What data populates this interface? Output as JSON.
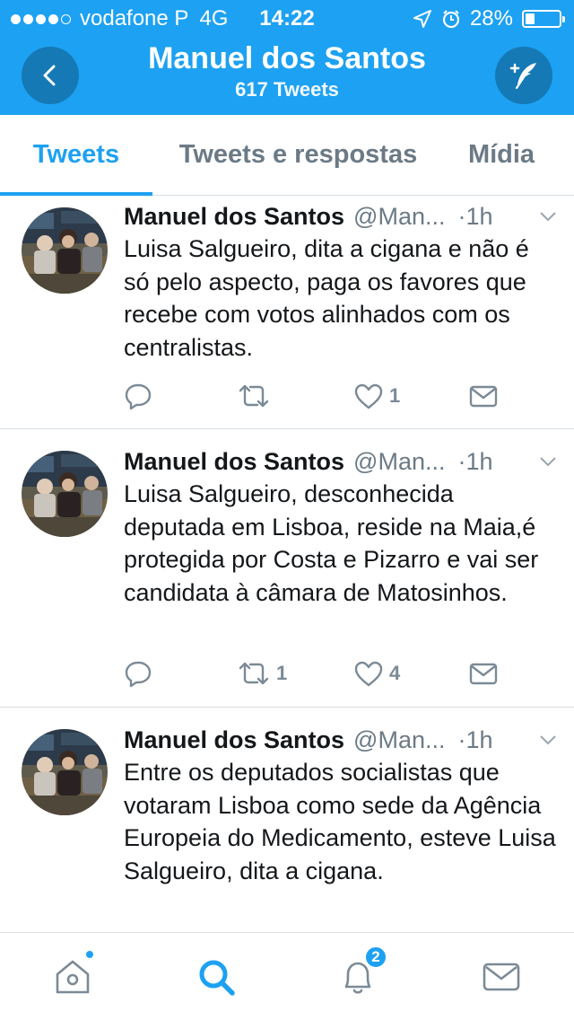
{
  "status_bar": {
    "carrier": "vodafone P",
    "network": "4G",
    "time": "14:22",
    "battery": "28%",
    "battery_level": 0.28,
    "signal_bars_filled": 4,
    "signal_bars_total": 5
  },
  "header": {
    "title": "Manuel dos Santos",
    "subtitle": "617 Tweets",
    "back_icon": "chevron-left-icon",
    "compose_icon": "compose-tweet-icon"
  },
  "tabs": [
    {
      "label": "Tweets",
      "active": true
    },
    {
      "label": "Tweets e respostas",
      "active": false
    },
    {
      "label": "Mídia",
      "active": false
    }
  ],
  "tweets": [
    {
      "name": "Manuel dos Santos",
      "handle": "@Man...",
      "separator": "·",
      "time": "1h",
      "text": "Luisa Salgueiro, dita a cigana e não é só pelo aspecto, paga os favores que recebe com votos alinhados com os centralistas.",
      "replies": "",
      "retweets": "",
      "likes": "1"
    },
    {
      "name": "Manuel dos Santos",
      "handle": "@Man...",
      "separator": "·",
      "time": "1h",
      "text": "Luisa Salgueiro, desconhecida deputada em Lisboa, reside na Maia,é protegida por Costa e Pizarro e vai ser candidata à câmara de Matosinhos.",
      "replies": "",
      "retweets": "1",
      "likes": "4"
    },
    {
      "name": "Manuel dos Santos",
      "handle": "@Man...",
      "separator": "·",
      "time": "1h",
      "text": "Entre os deputados socialistas que votaram Lisboa como sede da Agência Europeia do Medicamento, esteve Luisa Salgueiro, dita a cigana.",
      "replies": "",
      "retweets": "",
      "likes": ""
    }
  ],
  "bottom_nav": {
    "items": [
      "home-icon",
      "search-icon",
      "notifications-icon",
      "messages-icon"
    ],
    "notifications_badge": "2"
  },
  "colors": {
    "accent": "#1da1f2",
    "header_button": "#1579b5",
    "muted": "#6b7a86",
    "divider": "#d8dee3"
  }
}
